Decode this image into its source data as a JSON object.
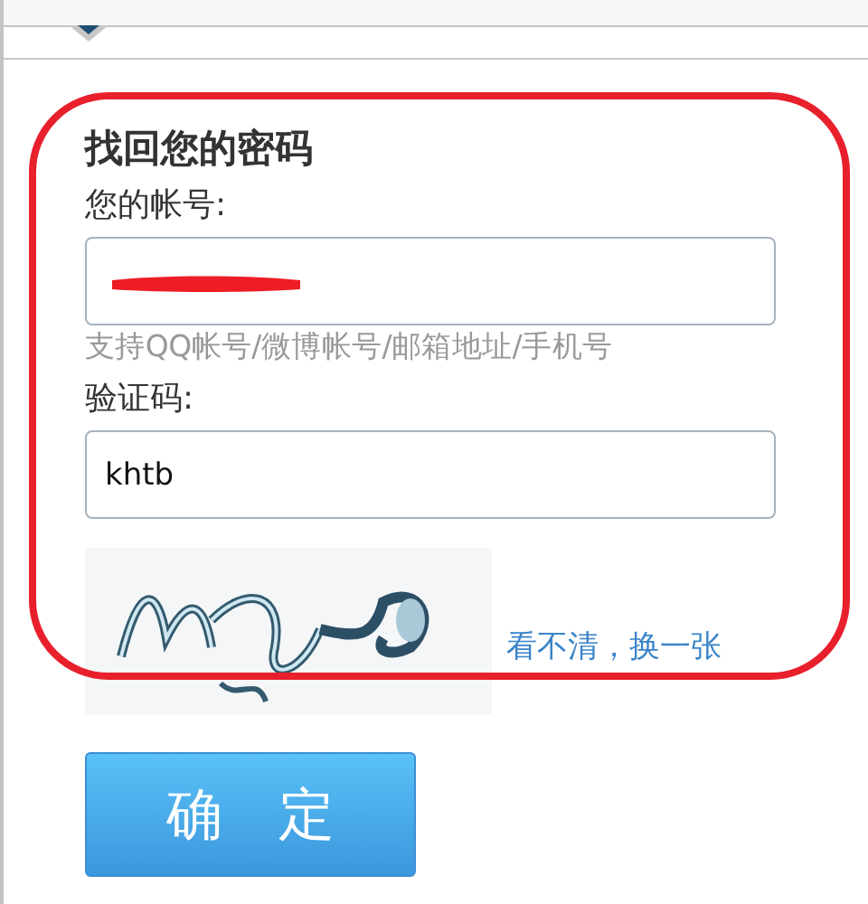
{
  "form": {
    "title": "找回您的密码",
    "fields": [
      {
        "label": "您的帐号:",
        "redacted": true,
        "hint": "支持QQ帐号/微博帐号/邮箱地址/手机号"
      },
      {
        "label": "验证码:",
        "value": "khtb"
      }
    ],
    "captcha": {
      "kind": "picture",
      "refresh_link": "看不清，换一张"
    },
    "submit": "确　定"
  }
}
